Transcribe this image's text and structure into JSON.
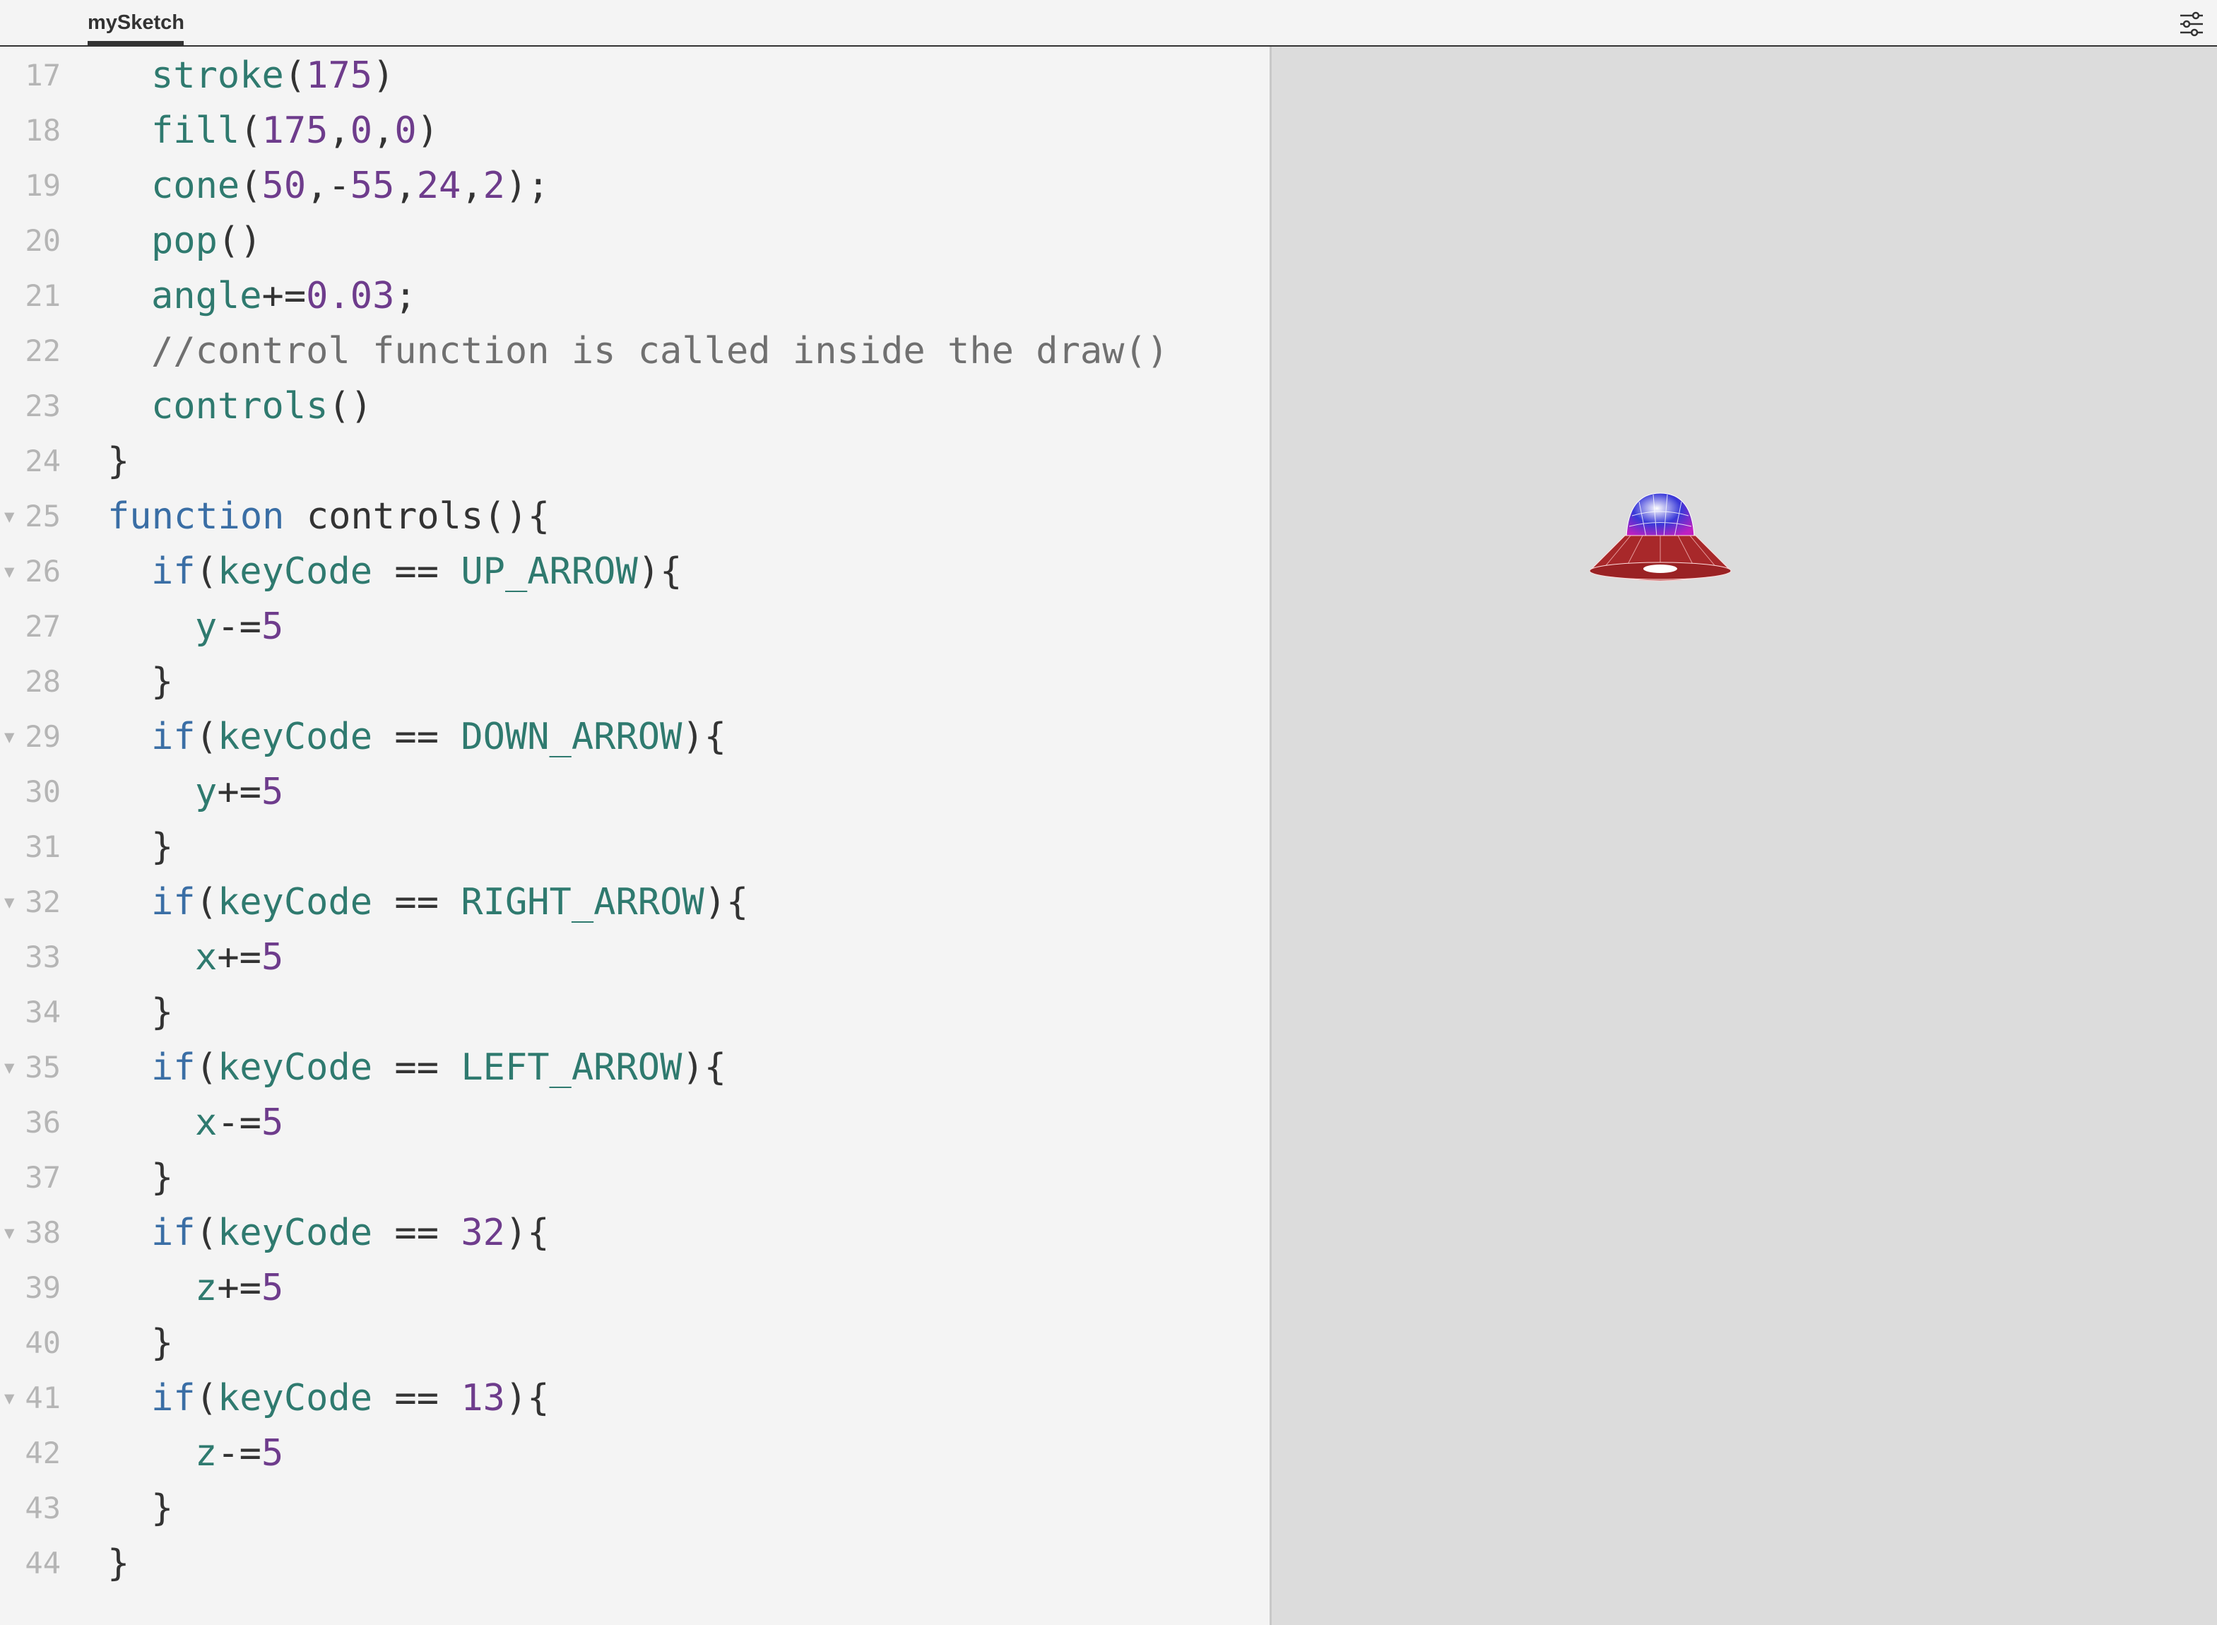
{
  "tab": {
    "label": "mySketch"
  },
  "settings_icon": "sliders-icon",
  "colors": {
    "function_call": "#2f7a6f",
    "keyword": "#3a6ea5",
    "number": "#6e3c8c",
    "comment": "#707070",
    "hat_brim": "#a8282a",
    "hat_dome": "#3030d0"
  },
  "lines": [
    {
      "num": "17",
      "fold": false,
      "indent": 1,
      "tokens": [
        [
          "fn",
          "stroke"
        ],
        [
          "pl",
          "("
        ],
        [
          "num",
          "175"
        ],
        [
          "pl",
          ")"
        ]
      ]
    },
    {
      "num": "18",
      "fold": false,
      "indent": 1,
      "tokens": [
        [
          "fn",
          "fill"
        ],
        [
          "pl",
          "("
        ],
        [
          "num",
          "175"
        ],
        [
          "pl",
          ","
        ],
        [
          "num",
          "0"
        ],
        [
          "pl",
          ","
        ],
        [
          "num",
          "0"
        ],
        [
          "pl",
          ")"
        ]
      ]
    },
    {
      "num": "19",
      "fold": false,
      "indent": 1,
      "tokens": [
        [
          "fn",
          "cone"
        ],
        [
          "pl",
          "("
        ],
        [
          "num",
          "50"
        ],
        [
          "pl",
          ",-"
        ],
        [
          "num",
          "55"
        ],
        [
          "pl",
          ","
        ],
        [
          "num",
          "24"
        ],
        [
          "pl",
          ","
        ],
        [
          "num",
          "2"
        ],
        [
          "pl",
          ");"
        ]
      ]
    },
    {
      "num": "20",
      "fold": false,
      "indent": 1,
      "tokens": [
        [
          "fn",
          "pop"
        ],
        [
          "pl",
          "()"
        ]
      ]
    },
    {
      "num": "21",
      "fold": false,
      "indent": 1,
      "tokens": [
        [
          "fn",
          "angle"
        ],
        [
          "pl",
          "+="
        ],
        [
          "num",
          "0.03"
        ],
        [
          "pl",
          ";"
        ]
      ]
    },
    {
      "num": "22",
      "fold": false,
      "indent": 1,
      "tokens": [
        [
          "cm",
          "//control function is called inside the draw()"
        ]
      ]
    },
    {
      "num": "23",
      "fold": false,
      "indent": 1,
      "tokens": [
        [
          "fn",
          "controls"
        ],
        [
          "pl",
          "()"
        ]
      ]
    },
    {
      "num": "24",
      "fold": false,
      "indent": 0,
      "tokens": [
        [
          "pl",
          "}"
        ]
      ]
    },
    {
      "num": "25",
      "fold": true,
      "indent": 0,
      "tokens": [
        [
          "kw",
          "function"
        ],
        [
          "pl",
          " controls(){"
        ]
      ]
    },
    {
      "num": "26",
      "fold": true,
      "indent": 1,
      "tokens": [
        [
          "kw",
          "if"
        ],
        [
          "pl",
          "("
        ],
        [
          "fn",
          "keyCode"
        ],
        [
          "pl",
          " == "
        ],
        [
          "fn",
          "UP_ARROW"
        ],
        [
          "pl",
          "){"
        ]
      ]
    },
    {
      "num": "27",
      "fold": false,
      "indent": 2,
      "tokens": [
        [
          "fn",
          "y"
        ],
        [
          "pl",
          "-="
        ],
        [
          "num",
          "5"
        ]
      ]
    },
    {
      "num": "28",
      "fold": false,
      "indent": 1,
      "tokens": [
        [
          "pl",
          "}"
        ]
      ]
    },
    {
      "num": "29",
      "fold": true,
      "indent": 1,
      "tokens": [
        [
          "kw",
          "if"
        ],
        [
          "pl",
          "("
        ],
        [
          "fn",
          "keyCode"
        ],
        [
          "pl",
          " == "
        ],
        [
          "fn",
          "DOWN_ARROW"
        ],
        [
          "pl",
          "){"
        ]
      ]
    },
    {
      "num": "30",
      "fold": false,
      "indent": 2,
      "tokens": [
        [
          "fn",
          "y"
        ],
        [
          "pl",
          "+="
        ],
        [
          "num",
          "5"
        ]
      ]
    },
    {
      "num": "31",
      "fold": false,
      "indent": 1,
      "tokens": [
        [
          "pl",
          "}"
        ]
      ]
    },
    {
      "num": "32",
      "fold": true,
      "indent": 1,
      "tokens": [
        [
          "kw",
          "if"
        ],
        [
          "pl",
          "("
        ],
        [
          "fn",
          "keyCode"
        ],
        [
          "pl",
          " == "
        ],
        [
          "fn",
          "RIGHT_ARROW"
        ],
        [
          "pl",
          "){"
        ]
      ]
    },
    {
      "num": "33",
      "fold": false,
      "indent": 2,
      "tokens": [
        [
          "fn",
          "x"
        ],
        [
          "pl",
          "+="
        ],
        [
          "num",
          "5"
        ]
      ]
    },
    {
      "num": "34",
      "fold": false,
      "indent": 1,
      "tokens": [
        [
          "pl",
          "}"
        ]
      ]
    },
    {
      "num": "35",
      "fold": true,
      "indent": 1,
      "tokens": [
        [
          "kw",
          "if"
        ],
        [
          "pl",
          "("
        ],
        [
          "fn",
          "keyCode"
        ],
        [
          "pl",
          " == "
        ],
        [
          "fn",
          "LEFT_ARROW"
        ],
        [
          "pl",
          "){"
        ]
      ]
    },
    {
      "num": "36",
      "fold": false,
      "indent": 2,
      "tokens": [
        [
          "fn",
          "x"
        ],
        [
          "pl",
          "-="
        ],
        [
          "num",
          "5"
        ]
      ]
    },
    {
      "num": "37",
      "fold": false,
      "indent": 1,
      "tokens": [
        [
          "pl",
          "}"
        ]
      ]
    },
    {
      "num": "38",
      "fold": true,
      "indent": 1,
      "tokens": [
        [
          "kw",
          "if"
        ],
        [
          "pl",
          "("
        ],
        [
          "fn",
          "keyCode"
        ],
        [
          "pl",
          " == "
        ],
        [
          "num",
          "32"
        ],
        [
          "pl",
          "){"
        ]
      ]
    },
    {
      "num": "39",
      "fold": false,
      "indent": 2,
      "tokens": [
        [
          "fn",
          "z"
        ],
        [
          "pl",
          "+="
        ],
        [
          "num",
          "5"
        ]
      ]
    },
    {
      "num": "40",
      "fold": false,
      "indent": 1,
      "tokens": [
        [
          "pl",
          "}"
        ]
      ]
    },
    {
      "num": "41",
      "fold": true,
      "indent": 1,
      "tokens": [
        [
          "kw",
          "if"
        ],
        [
          "pl",
          "("
        ],
        [
          "fn",
          "keyCode"
        ],
        [
          "pl",
          " == "
        ],
        [
          "num",
          "13"
        ],
        [
          "pl",
          "){"
        ]
      ]
    },
    {
      "num": "42",
      "fold": false,
      "indent": 2,
      "tokens": [
        [
          "fn",
          "z"
        ],
        [
          "pl",
          "-="
        ],
        [
          "num",
          "5"
        ]
      ]
    },
    {
      "num": "43",
      "fold": false,
      "indent": 1,
      "tokens": [
        [
          "pl",
          "}"
        ]
      ]
    },
    {
      "num": "44",
      "fold": false,
      "indent": 0,
      "tokens": [
        [
          "pl",
          "}"
        ]
      ]
    }
  ]
}
